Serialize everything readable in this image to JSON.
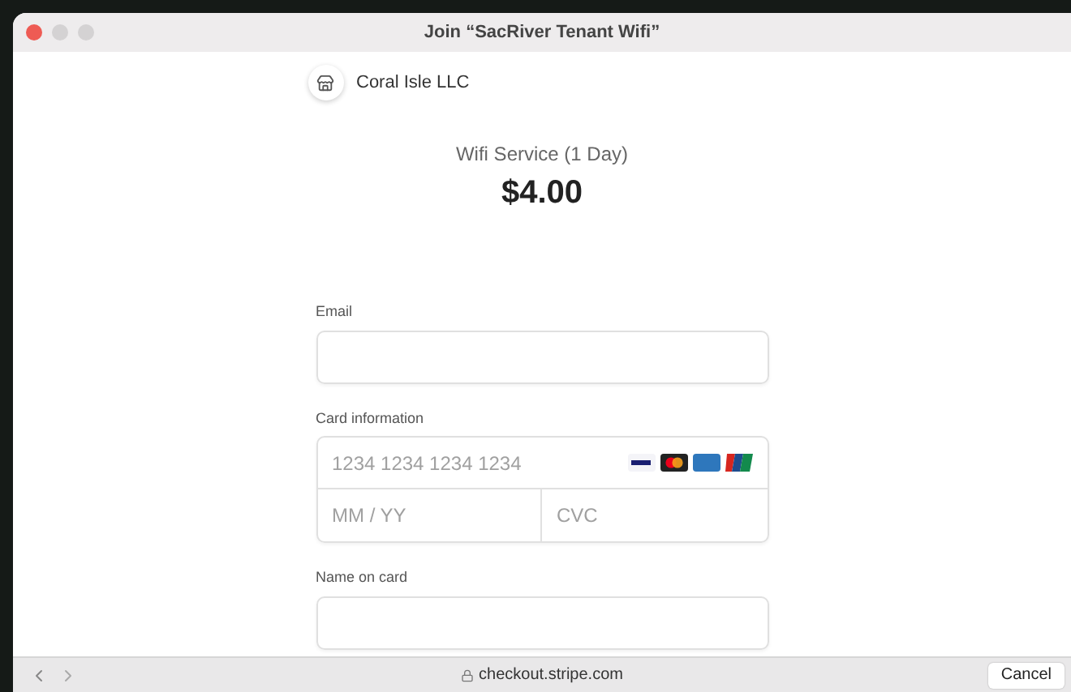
{
  "window": {
    "title": "Join “SacRiver Tenant Wifi”"
  },
  "merchant": {
    "name": "Coral Isle LLC"
  },
  "product": {
    "name": "Wifi Service (1 Day)",
    "price": "$4.00"
  },
  "form": {
    "email": {
      "label": "Email"
    },
    "card": {
      "label": "Card information",
      "number_placeholder": "1234 1234 1234 1234",
      "expiry_placeholder": "MM / YY",
      "cvc_placeholder": "CVC"
    },
    "name": {
      "label": "Name on card"
    }
  },
  "bottom_bar": {
    "url": "checkout.stripe.com",
    "cancel": "Cancel"
  }
}
